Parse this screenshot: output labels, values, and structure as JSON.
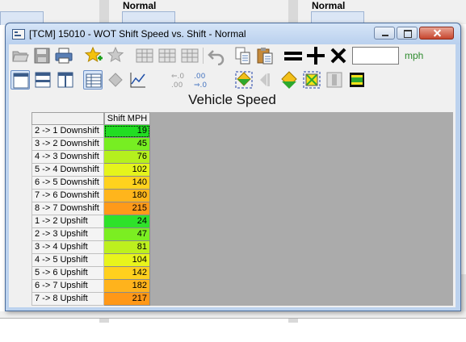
{
  "background": {
    "labels": [
      "Normal",
      "Normal"
    ]
  },
  "window": {
    "title": "[TCM] 15010 - WOT Shift Speed vs. Shift - Normal"
  },
  "toolbar": {
    "row1": [
      "open-icon",
      "save-icon",
      "print-icon",
      "favorite-add-icon",
      "favorite-remove-icon",
      "table-grid-icon",
      "table-grid-alt-icon",
      "table-grid-3d-icon",
      "undo-icon",
      "copy-icon",
      "paste-icon",
      "equals-icon",
      "plus-icon",
      "multiply-icon"
    ],
    "value_input": "",
    "units": "mph",
    "row2": [
      "view-single-icon",
      "view-split-horizontal-icon",
      "view-split-vertical-icon",
      "view-table-icon",
      "view-3d-icon",
      "view-graph-icon",
      "decimal-decrease-icon",
      "decimal-increase-icon",
      "smooth-icon",
      "interpolate-icon",
      "fill-icon",
      "select-all-icon",
      "compare-icon",
      "highlight-icon"
    ]
  },
  "table": {
    "title": "Vehicle Speed",
    "column_header": "Shift MPH",
    "rows": [
      {
        "label": "2 -> 1 Downshift",
        "value": "19",
        "color": "#22dd22"
      },
      {
        "label": "3 -> 2 Downshift",
        "value": "45",
        "color": "#77ee22"
      },
      {
        "label": "4 -> 3 Downshift",
        "value": "76",
        "color": "#b5f01e"
      },
      {
        "label": "5 -> 4 Downshift",
        "value": "102",
        "color": "#e5f41c"
      },
      {
        "label": "6 -> 5 Downshift",
        "value": "140",
        "color": "#ffd21e"
      },
      {
        "label": "7 -> 6 Downshift",
        "value": "180",
        "color": "#ffb51c"
      },
      {
        "label": "8 -> 7 Downshift",
        "value": "215",
        "color": "#ff9a1a"
      },
      {
        "label": "1 -> 2 Upshift",
        "value": "24",
        "color": "#2ee22a"
      },
      {
        "label": "2 -> 3 Upshift",
        "value": "47",
        "color": "#7bee22"
      },
      {
        "label": "3 -> 4 Upshift",
        "value": "81",
        "color": "#bdf01e"
      },
      {
        "label": "4 -> 5 Upshift",
        "value": "104",
        "color": "#e8f41c"
      },
      {
        "label": "5 -> 6 Upshift",
        "value": "142",
        "color": "#ffd01e"
      },
      {
        "label": "6 -> 7 Upshift",
        "value": "182",
        "color": "#ffb31c"
      },
      {
        "label": "7 -> 8 Upshift",
        "value": "217",
        "color": "#ff9818"
      }
    ]
  }
}
